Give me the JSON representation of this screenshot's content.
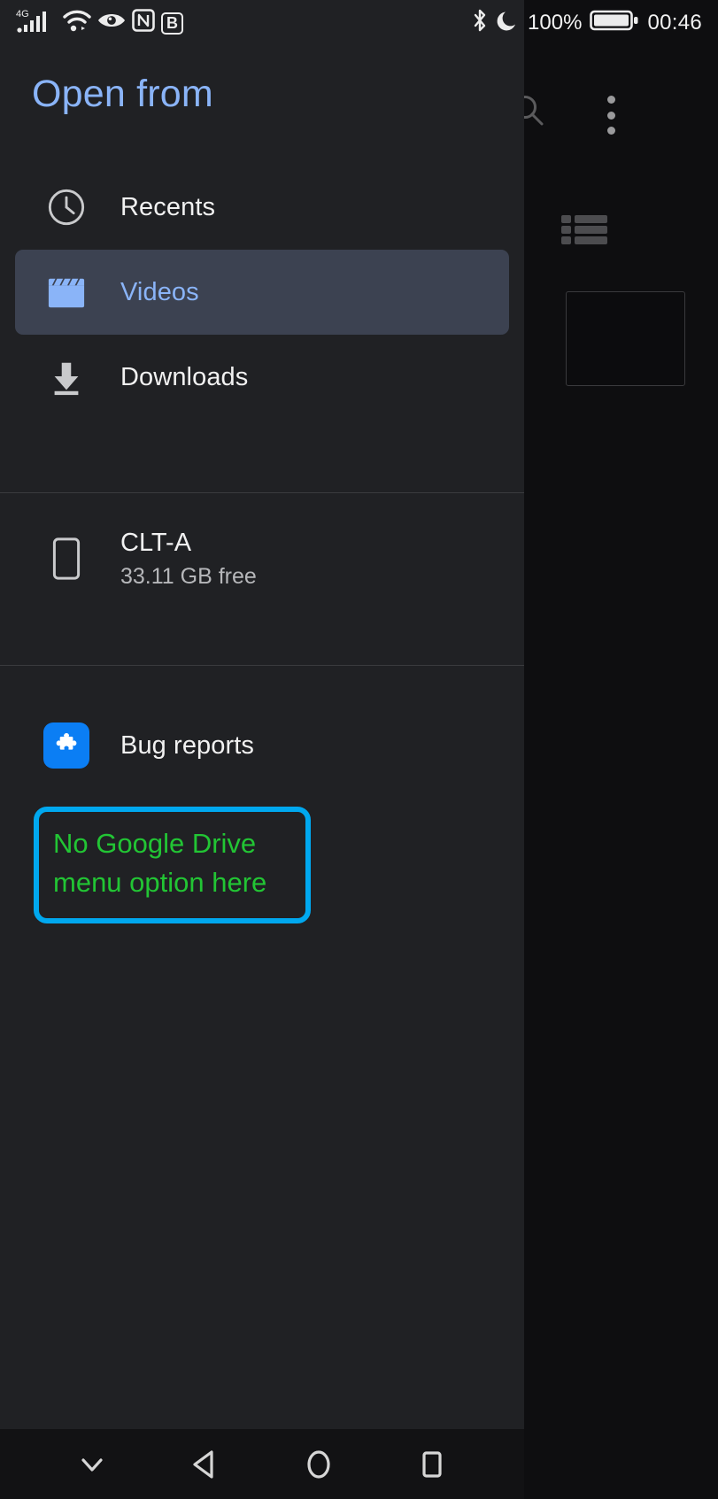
{
  "status_bar": {
    "network_label": "4G",
    "icons_left": [
      "signal-icon",
      "wifi-icon",
      "eye-icon",
      "nfc-icon",
      "bluetooth-b-icon"
    ],
    "nfc_label": "N",
    "b_label": "B",
    "bluetooth_icon": "bluetooth-icon",
    "dnd_icon": "moon-icon",
    "battery_percent": "100%",
    "battery_icon": "battery-full-icon",
    "clock": "00:46"
  },
  "drawer": {
    "title": "Open from",
    "items": [
      {
        "label": "Recents",
        "icon": "clock-icon",
        "selected": false
      },
      {
        "label": "Videos",
        "icon": "movie-clapper-icon",
        "selected": true
      },
      {
        "label": "Downloads",
        "icon": "download-icon",
        "selected": false
      }
    ],
    "device": {
      "name": "CLT-A",
      "subtitle": "33.11 GB free",
      "icon": "phone-icon"
    },
    "apps": [
      {
        "label": "Bug reports",
        "icon": "puzzle-piece-icon"
      }
    ]
  },
  "annotation": {
    "text": "No Google Drive\nmenu option here",
    "border_color": "#00a8ef",
    "text_color": "#22c534"
  },
  "background_app": {
    "search_icon": "search-icon",
    "overflow_icon": "more-vert-icon",
    "list_view_icon": "list-view-icon",
    "card": "file-card"
  },
  "navigation_bar": {
    "buttons": [
      {
        "name": "hide-keyboard-button",
        "icon": "chevron-down-icon"
      },
      {
        "name": "back-button",
        "icon": "triangle-back-icon"
      },
      {
        "name": "home-button",
        "icon": "circle-home-icon"
      },
      {
        "name": "recents-button",
        "icon": "square-recents-icon"
      }
    ]
  },
  "colors": {
    "accent_blue": "#8ab4f8",
    "selected_row": "#3c4251",
    "drawer_bg": "#202124",
    "app_badge_blue": "#0b7ef4"
  }
}
